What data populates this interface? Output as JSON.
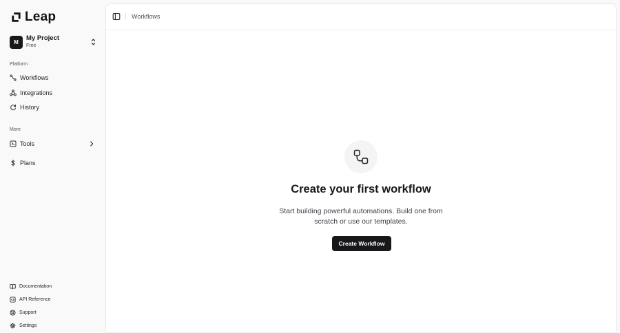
{
  "brand": {
    "name": "Leap",
    "icon": "leap-logo-icon"
  },
  "project": {
    "avatar_letter": "M",
    "name": "My Project",
    "plan": "Free",
    "icon": "chevrons-up-down-icon"
  },
  "sidebar": {
    "platform_label": "Platform",
    "platform_items": [
      {
        "label": "Workflows",
        "icon": "workflow-icon"
      },
      {
        "label": "Integrations",
        "icon": "integrations-icon"
      },
      {
        "label": "History",
        "icon": "history-icon"
      }
    ],
    "more_label": "More",
    "more_items": [
      {
        "label": "Tools",
        "icon": "tools-icon",
        "trailing_icon": "chevron-right-icon"
      },
      {
        "label": "Plans",
        "icon": "dollar-icon"
      }
    ],
    "footer_items": [
      {
        "label": "Documentation",
        "icon": "book-icon"
      },
      {
        "label": "API Reference",
        "icon": "code-icon"
      },
      {
        "label": "Support",
        "icon": "lifebuoy-icon"
      },
      {
        "label": "Settings",
        "icon": "gear-icon"
      }
    ]
  },
  "header": {
    "breadcrumb": "Workflows",
    "toggle_icon": "sidebar-toggle-icon"
  },
  "empty_state": {
    "icon": "workflow-icon",
    "title": "Create your first workflow",
    "description": "Start building powerful automations. Build one from scratch or use our templates.",
    "button_label": "Create Workflow"
  },
  "colors": {
    "primary": "#18181b",
    "background": "#f9f9f9",
    "surface": "#ffffff",
    "muted": "#f4f4f5",
    "border": "#ececee"
  }
}
